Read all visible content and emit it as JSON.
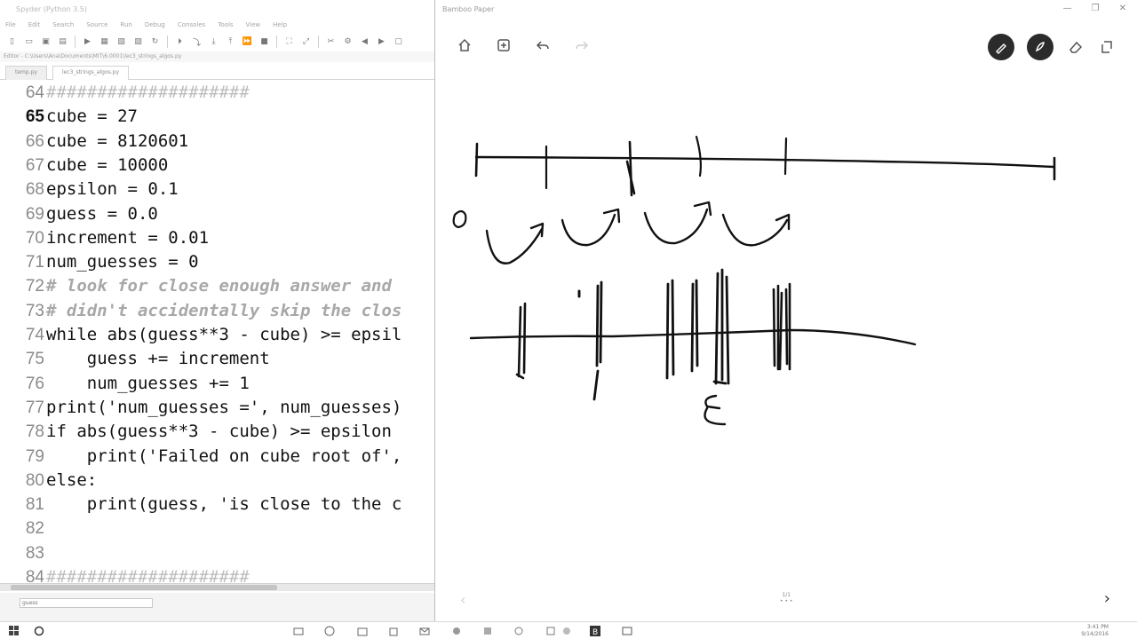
{
  "editor": {
    "title": "Spyder (Python 3.5)",
    "menu": [
      "File",
      "Edit",
      "Search",
      "Source",
      "Run",
      "Debug",
      "Consoles",
      "Tools",
      "View",
      "Help"
    ],
    "path": "Editor - C:\\Users\\Ana\\Documents\\MIT\\6.0001\\lec3_strings_algos.py",
    "tabs": [
      "temp.py",
      "lec3_strings_algos.py"
    ],
    "current_line": "65",
    "lines": [
      {
        "num": "64",
        "text": "####################",
        "style": "hashes"
      },
      {
        "num": "65",
        "text": "cube = 27",
        "style": "code"
      },
      {
        "num": "66",
        "text": "cube = 8120601",
        "style": "code"
      },
      {
        "num": "67",
        "text": "cube = 10000",
        "style": "code"
      },
      {
        "num": "68",
        "text": "epsilon = 0.1",
        "style": "code"
      },
      {
        "num": "69",
        "text": "guess = 0.0",
        "style": "code"
      },
      {
        "num": "70",
        "text": "increment = 0.01",
        "style": "code"
      },
      {
        "num": "71",
        "text": "num_guesses = 0",
        "style": "code"
      },
      {
        "num": "72",
        "text": "# look for close enough answer and",
        "style": "comment"
      },
      {
        "num": "73",
        "text": "# didn't accidentally skip the clos",
        "style": "comment"
      },
      {
        "num": "74",
        "text": "while abs(guess**3 - cube) >= epsil",
        "style": "code"
      },
      {
        "num": "75",
        "text": "    guess += increment",
        "style": "code"
      },
      {
        "num": "76",
        "text": "    num_guesses += 1",
        "style": "code"
      },
      {
        "num": "77",
        "text": "print('num_guesses =', num_guesses)",
        "style": "code"
      },
      {
        "num": "78",
        "text": "if abs(guess**3 - cube) >= epsilon",
        "style": "code"
      },
      {
        "num": "79",
        "text": "    print('Failed on cube root of',",
        "style": "code"
      },
      {
        "num": "80",
        "text": "else:",
        "style": "code"
      },
      {
        "num": "81",
        "text": "    print(guess, 'is close to the c",
        "style": "code"
      },
      {
        "num": "82",
        "text": "",
        "style": "code"
      },
      {
        "num": "83",
        "text": "",
        "style": "code"
      },
      {
        "num": "84",
        "text": "####################",
        "style": "hashes"
      }
    ],
    "shell_input": "guess"
  },
  "paper": {
    "title": "Bamboo Paper",
    "page_indicator": "1/1",
    "handwriting": {
      "zero_label": "0",
      "epsilon_label": "ε"
    },
    "tool_icons": [
      "home-icon",
      "add-page-icon",
      "undo-icon",
      "redo-icon",
      "pen-icon",
      "brush-icon",
      "eraser-icon",
      "page-tools-icon"
    ]
  },
  "taskbar": {
    "clock_time": "3:41 PM",
    "clock_date": "9/14/2016"
  }
}
